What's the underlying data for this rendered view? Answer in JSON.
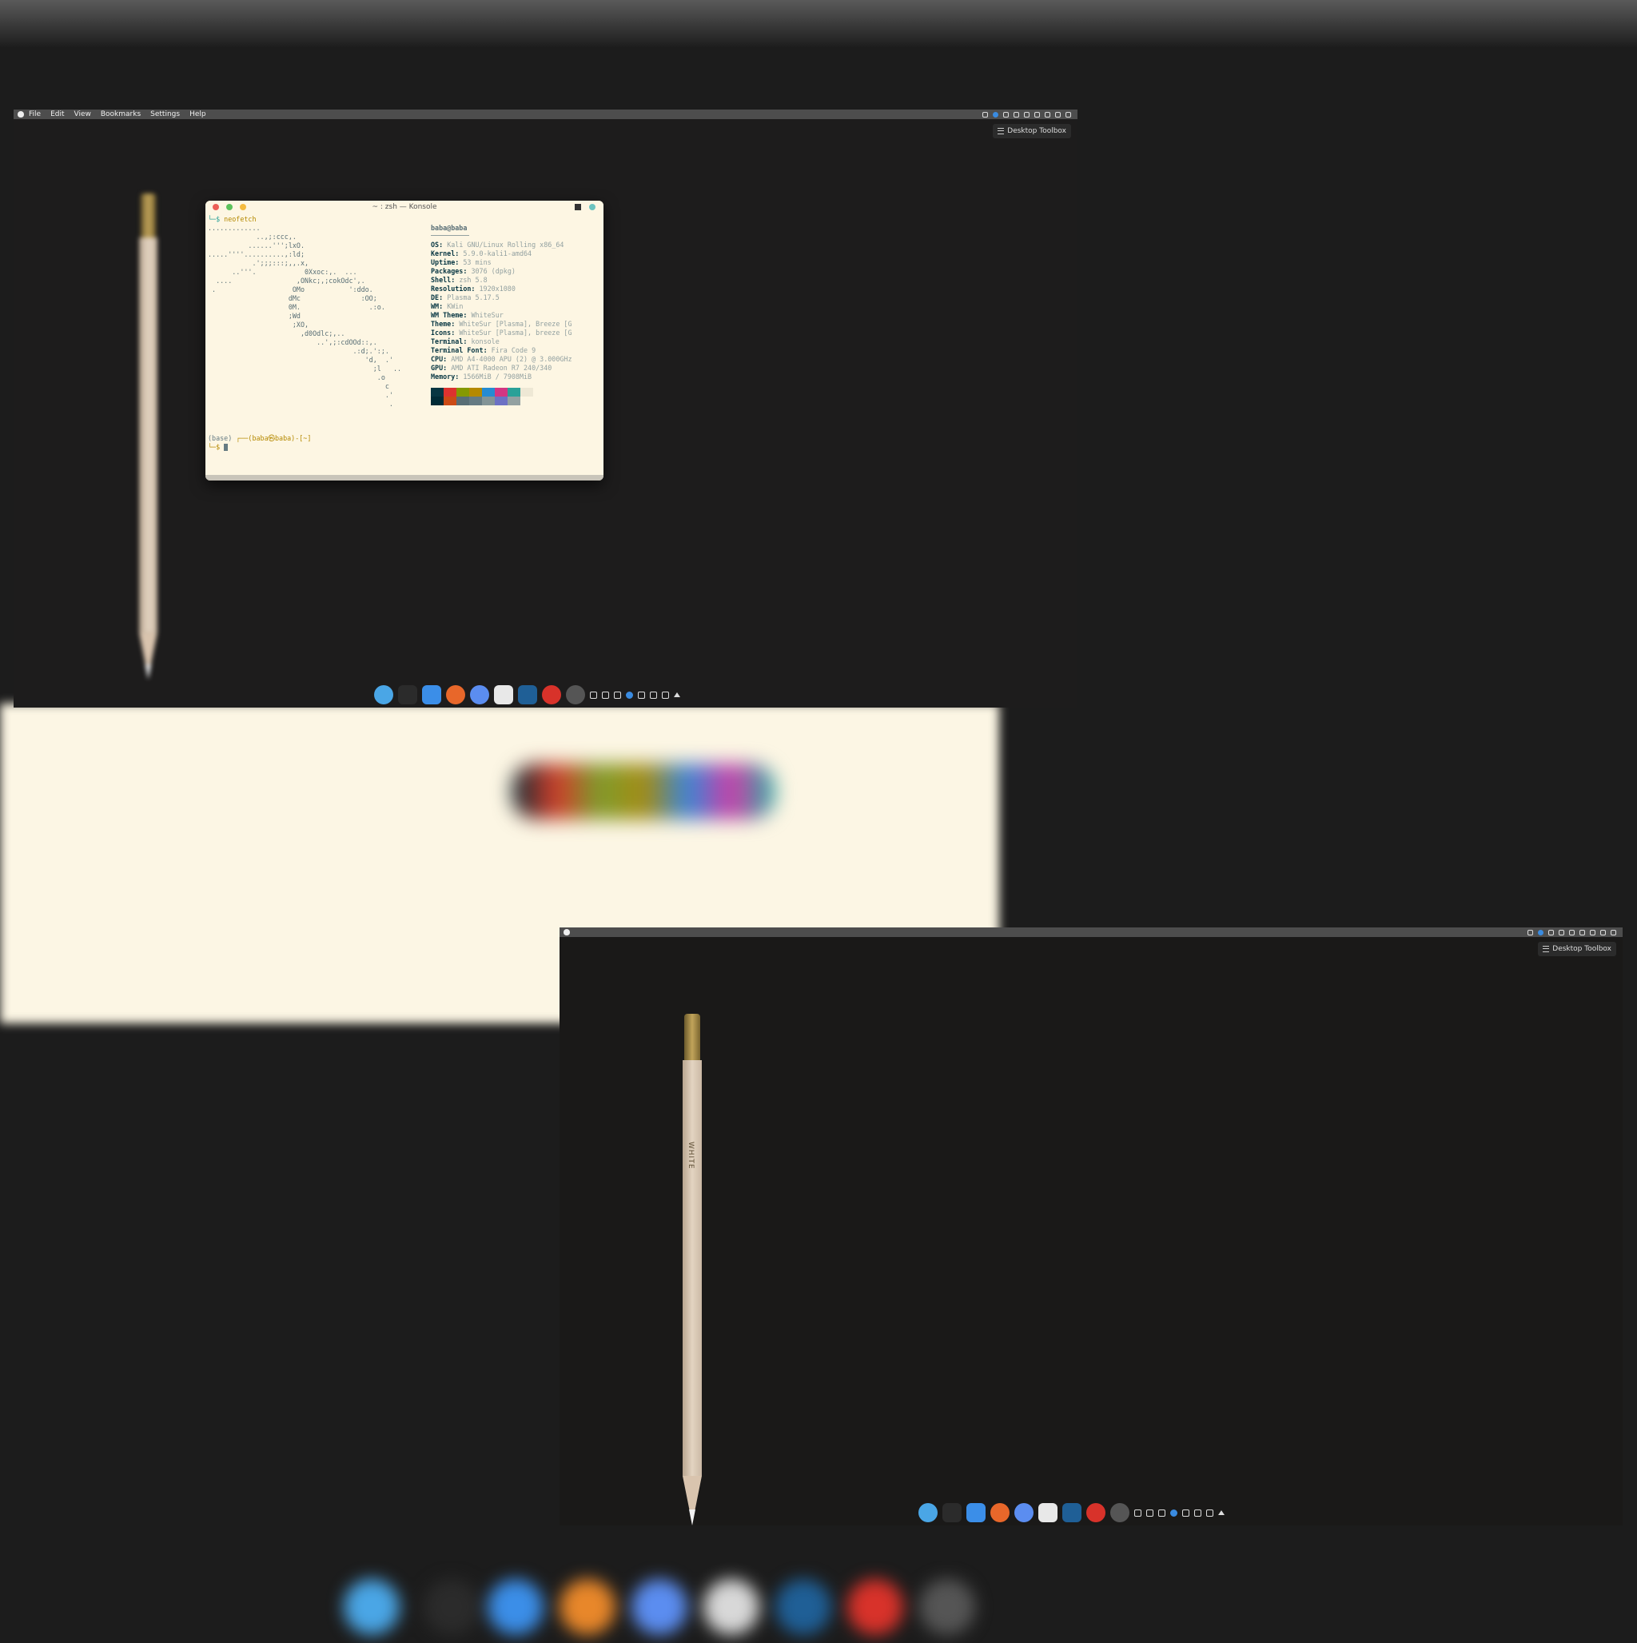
{
  "menubar": {
    "menus": [
      "File",
      "Edit",
      "View",
      "Bookmarks",
      "Settings",
      "Help"
    ]
  },
  "toolbox": {
    "label": "Desktop Toolbox"
  },
  "konsole": {
    "title": "~ : zsh — Konsole",
    "command_prefix": "└─$ ",
    "command": "neofetch",
    "ascii_art": ".............\n            ..,;:ccc,.\n          ......''';lxO.\n.....''''..........,:ld;\n           .';;;:::;,,.x,\n      ..'''.            0Xxoc:,.  ...\n  ....                ,ONkc;,;cokOdc',.\n .                   OMo           ':ddo.\n                    dMc               :OO;\n                    0M.                 .:o.\n                    ;Wd\n                     ;XO,\n                       ,d0Odlc;,..\n                           ..',;:cdOOd::,.\n                                    .:d;.':;.\n                                       'd,  .'\n                                         ;l   ..\n                                          .o\n                                            c\n                                            .'\n                                             .",
    "user_host": "baba@baba",
    "info": [
      {
        "key": "OS",
        "value": "Kali GNU/Linux Rolling x86_64"
      },
      {
        "key": "Kernel",
        "value": "5.9.0-kali1-amd64"
      },
      {
        "key": "Uptime",
        "value": "53 mins"
      },
      {
        "key": "Packages",
        "value": "3076 (dpkg)"
      },
      {
        "key": "Shell",
        "value": "zsh 5.8"
      },
      {
        "key": "Resolution",
        "value": "1920x1080"
      },
      {
        "key": "DE",
        "value": "Plasma 5.17.5"
      },
      {
        "key": "WM",
        "value": "KWin"
      },
      {
        "key": "WM Theme",
        "value": "WhiteSur"
      },
      {
        "key": "Theme",
        "value": "WhiteSur [Plasma], Breeze [G"
      },
      {
        "key": "Icons",
        "value": "WhiteSur [Plasma], breeze [G"
      },
      {
        "key": "Terminal",
        "value": "konsole"
      },
      {
        "key": "Terminal Font",
        "value": "Fira Code 9"
      },
      {
        "key": "CPU",
        "value": "AMD A4-4000 APU (2) @ 3.000GHz"
      },
      {
        "key": "GPU",
        "value": "AMD ATI Radeon R7 240/340"
      },
      {
        "key": "Memory",
        "value": "1566MiB / 7908MiB"
      }
    ],
    "swatches_row1": [
      "#073642",
      "#dc322f",
      "#859900",
      "#b58900",
      "#268bd2",
      "#d33682",
      "#2aa198",
      "#eee8d5"
    ],
    "swatches_row2": [
      "#002b36",
      "#cb4b16",
      "#586e75",
      "#657b83",
      "#839496",
      "#6c71c4",
      "#93a1a1",
      "#fdf6e3"
    ],
    "prompt_env": "(base) ",
    "prompt_user": "┌──(baba㉿baba)-[~]",
    "prompt_line2": "└─$ "
  },
  "pencil": {
    "brand": "WHITE"
  },
  "dock": {
    "apps": [
      {
        "name": "browser-icon",
        "color": "#4aa6e6"
      },
      {
        "name": "terminal-icon",
        "color": "#2b2b2b"
      },
      {
        "name": "finder-icon",
        "color": "#3b8ee8"
      },
      {
        "name": "firefox-icon",
        "color": "#e8672a"
      },
      {
        "name": "chrome-icon",
        "color": "#5b8df0"
      },
      {
        "name": "text-editor-icon",
        "color": "#e8e8e8"
      },
      {
        "name": "vscode-icon",
        "color": "#1f5f96"
      },
      {
        "name": "app-red-icon",
        "color": "#d8322a"
      },
      {
        "name": "clock-icon",
        "color": "#555555"
      }
    ]
  }
}
